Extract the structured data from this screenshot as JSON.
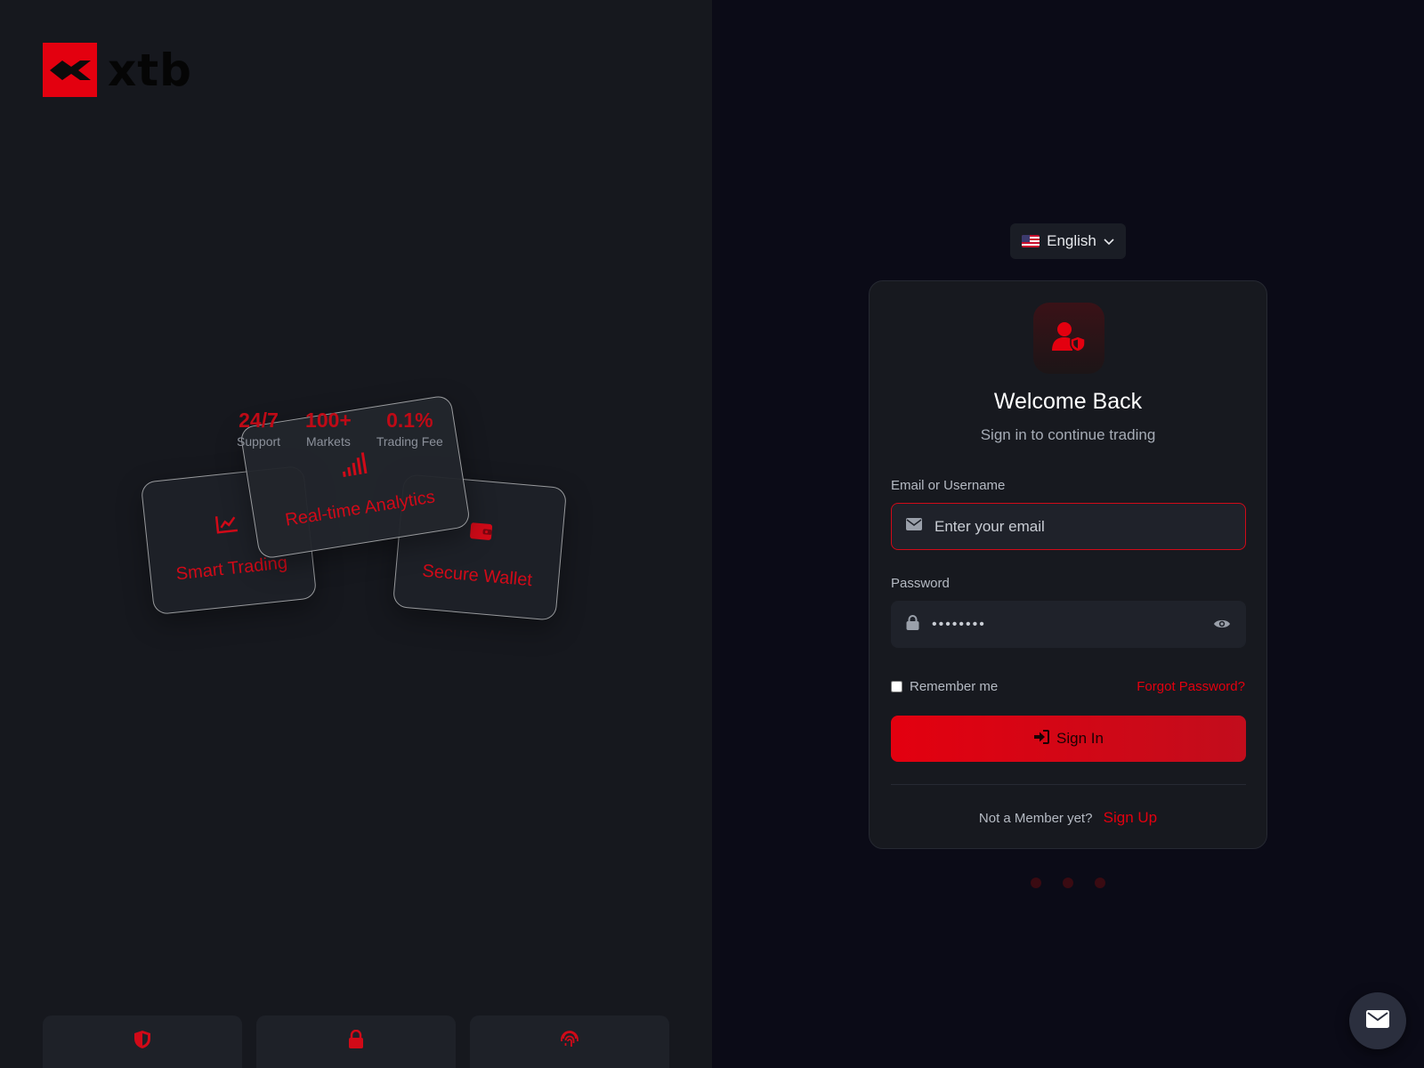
{
  "brand": {
    "name": "xtb",
    "accent_color": "#e3000f"
  },
  "showcase": {
    "stats": [
      {
        "value": "24/7",
        "label": "Support"
      },
      {
        "value": "100+",
        "label": "Markets"
      },
      {
        "value": "0.1%",
        "label": "Trading Fee"
      }
    ],
    "cards": [
      {
        "label": "Smart Trading",
        "icon": "line-chart-icon"
      },
      {
        "label": "Real-time Analytics",
        "icon": "signal-bars-icon"
      },
      {
        "label": "Secure Wallet",
        "icon": "wallet-icon"
      }
    ],
    "feature_tiles": [
      {
        "icon": "shield-icon"
      },
      {
        "icon": "lock-icon"
      },
      {
        "icon": "fingerprint-icon"
      }
    ]
  },
  "language": {
    "selected": "English",
    "flag": "us-flag-icon"
  },
  "login": {
    "title": "Welcome Back",
    "subtitle": "Sign in to continue trading",
    "email_label": "Email or Username",
    "email_placeholder": "Enter your email",
    "password_label": "Password",
    "password_value": "password",
    "remember_label": "Remember me",
    "forgot_label": "Forgot Password?",
    "signin_label": "Sign In",
    "not_member": "Not a Member yet?",
    "signup_label": "Sign Up"
  },
  "carousel": {
    "dot_count": 3
  }
}
